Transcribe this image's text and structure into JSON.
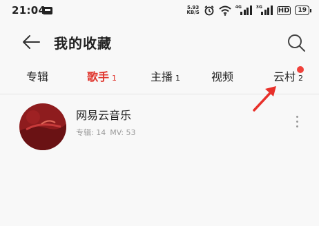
{
  "statusbar": {
    "time": "21:04",
    "speed_value": "5.93",
    "speed_unit": "KB/S",
    "sig1_label": "4G",
    "sig2_label": "3G",
    "hd": "HD",
    "battery": "19"
  },
  "header": {
    "title": "我的收藏"
  },
  "tabs": [
    {
      "label": "专辑",
      "count": ""
    },
    {
      "label": "歌手",
      "count": "1"
    },
    {
      "label": "主播",
      "count": "1"
    },
    {
      "label": "视频",
      "count": ""
    },
    {
      "label": "云村",
      "count": "2"
    }
  ],
  "active_tab": "歌手",
  "list": [
    {
      "name": "网易云音乐",
      "meta_albums": "专辑: 14",
      "meta_mv": "MV: 53"
    }
  ],
  "colors": {
    "accent": "#e0342c",
    "annotation_arrow": "#e8302a",
    "badge": "#f0413a"
  }
}
